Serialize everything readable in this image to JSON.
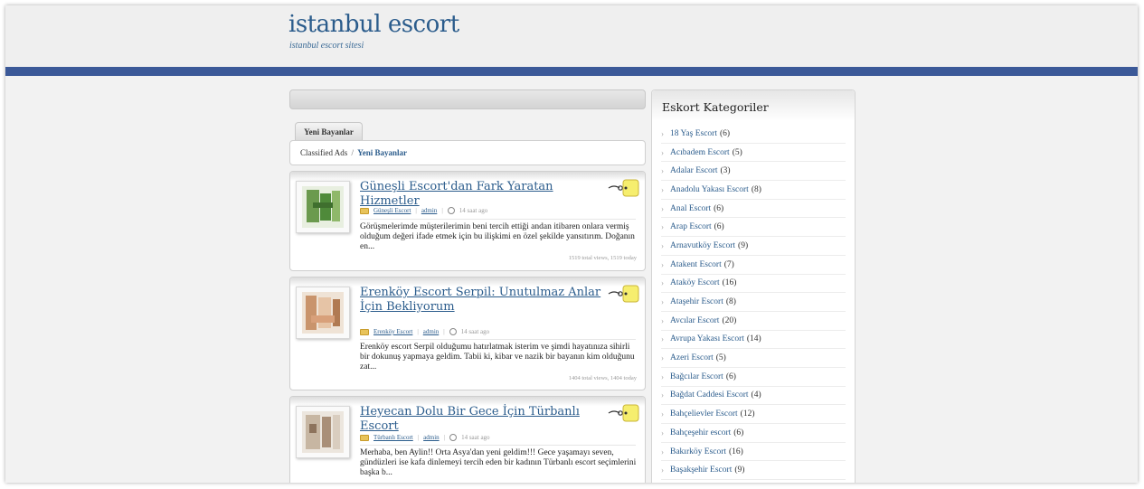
{
  "site": {
    "title": "istanbul escort",
    "tagline": "istanbul escort sitesi"
  },
  "colors": {
    "brand_blue": "#3b5998",
    "link": "#2b5c8c"
  },
  "tab": {
    "label": "Yeni Bayanlar"
  },
  "breadcrumb": {
    "root": "Classified Ads",
    "separator": "/",
    "current": "Yeni Bayanlar"
  },
  "posts": [
    {
      "title": "Güneşli Escort'dan Fark Yaratan Hizmetler",
      "category": "Güneşli Escort",
      "author": "admin",
      "time": "14 saat ago",
      "excerpt": "Görüşmelerimde müşterilerimin beni tercih ettiği andan itibaren onlara vermiş olduğum değeri ifade etmek için bu ilişkimi en özel şekilde yansıtırım. Doğanın en...",
      "views": "1519 total views, 1519 today"
    },
    {
      "title": "Erenköy Escort Serpil: Unutulmaz Anlar İçin Bekliyorum",
      "category": "Erenköy Escort",
      "author": "admin",
      "time": "14 saat ago",
      "excerpt": "Erenköy escort Serpil olduğumu hatırlatmak isterim ve şimdi hayatınıza sihirli bir dokunuş yapmaya geldim. Tabii ki, kibar ve nazik bir bayanın kim olduğunu zat...",
      "views": "1404 total views, 1404 today"
    },
    {
      "title": "Heyecan Dolu Bir Gece İçin Türbanlı Escort",
      "category": "Türbanlı Escort",
      "author": "admin",
      "time": "14 saat ago",
      "excerpt": "Merhaba, ben Aylin!! Orta Asya'dan yeni geldim!!! Gece yaşamayı seven, gündüzleri ise kafa dinlemeyi tercih eden bir kadının Türbanlı escort seçimlerini başka b...",
      "views": ""
    }
  ],
  "sidebar": {
    "title": "Eskort Kategoriler",
    "categories": [
      {
        "name": "18 Yaş Escort",
        "count": "(6)"
      },
      {
        "name": "Acıbadem Escort",
        "count": "(5)"
      },
      {
        "name": "Adalar Escort",
        "count": "(3)"
      },
      {
        "name": "Anadolu Yakası Escort",
        "count": "(8)"
      },
      {
        "name": "Anal Escort",
        "count": "(6)"
      },
      {
        "name": "Arap Escort",
        "count": "(6)"
      },
      {
        "name": "Arnavutköy Escort",
        "count": "(9)"
      },
      {
        "name": "Atakent Escort",
        "count": "(7)"
      },
      {
        "name": "Ataköy Escort",
        "count": "(16)"
      },
      {
        "name": "Ataşehir Escort",
        "count": "(8)"
      },
      {
        "name": "Avcılar Escort",
        "count": "(20)"
      },
      {
        "name": "Avrupa Yakası Escort",
        "count": "(14)"
      },
      {
        "name": "Azeri Escort",
        "count": "(5)"
      },
      {
        "name": "Bağcılar Escort",
        "count": "(6)"
      },
      {
        "name": "Bağdat Caddesi Escort",
        "count": "(4)"
      },
      {
        "name": "Bahçelievler Escort",
        "count": "(12)"
      },
      {
        "name": "Bahçeşehir escort",
        "count": "(6)"
      },
      {
        "name": "Bakırköy Escort",
        "count": "(16)"
      },
      {
        "name": "Başakşehir Escort",
        "count": "(9)"
      }
    ]
  }
}
